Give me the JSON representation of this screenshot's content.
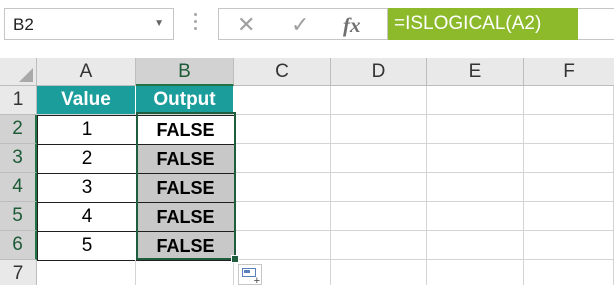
{
  "formula_bar": {
    "name_box": "B2",
    "name_box_arrow": "▼",
    "cancel_glyph": "✕",
    "enter_glyph": "✓",
    "fx_label": "fx",
    "formula": "=ISLOGICAL(A2)"
  },
  "columns": [
    "A",
    "B",
    "C",
    "D",
    "E",
    "F"
  ],
  "rows": [
    "1",
    "2",
    "3",
    "4",
    "5",
    "6",
    "7"
  ],
  "table": {
    "headers": [
      "Value",
      "Output"
    ],
    "values": [
      "1",
      "2",
      "3",
      "4",
      "5"
    ],
    "outputs": [
      "FALSE",
      "FALSE",
      "FALSE",
      "FALSE",
      "FALSE"
    ]
  },
  "quick_analysis": {
    "plus": "+"
  },
  "colors": {
    "header_fill": "#1a9d9b",
    "formula_highlight": "#8dba2b",
    "selection_border": "#1e5e3f",
    "output_fill": "#c8c8c8"
  }
}
